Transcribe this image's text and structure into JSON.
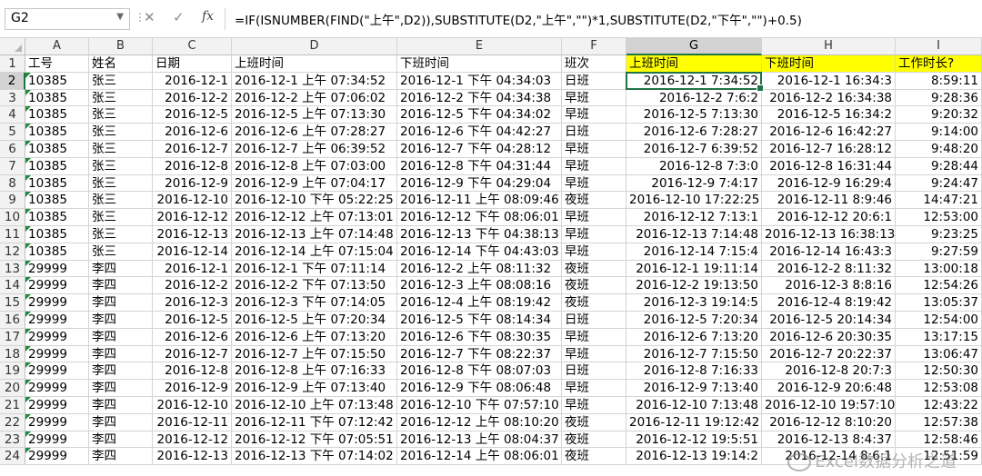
{
  "formula_bar": {
    "name_box": "G2",
    "fx": "fx",
    "cancel_icon": "✕",
    "enter_icon": "✓",
    "formula": "=IF(ISNUMBER(FIND(\"上午\",D2)),SUBSTITUTE(D2,\"上午\",\"\")*1,SUBSTITUTE(D2,\"下午\",\"\")+0.5)"
  },
  "columns": [
    "A",
    "B",
    "C",
    "D",
    "E",
    "F",
    "G",
    "H",
    "I"
  ],
  "selected_column": "G",
  "selected_row": 2,
  "highlight_color": "#ffff00",
  "header_row": [
    "工号",
    "姓名",
    "日期",
    "上班时间",
    "下班时间",
    "班次",
    "上班时间",
    "下班时间",
    "工作时长?"
  ],
  "rows": [
    [
      "10385",
      "张三",
      "2016-12-1",
      "2016-12-1 上午 07:34:52",
      "2016-12-1 下午 04:34:03",
      "日班",
      "2016-12-1 7:34:52",
      "2016-12-1 16:34:3",
      "8:59:11"
    ],
    [
      "10385",
      "张三",
      "2016-12-2",
      "2016-12-2 上午 07:06:02",
      "2016-12-2 下午 04:34:38",
      "早班",
      "2016-12-2 7:6:2",
      "2016-12-2 16:34:38",
      "9:28:36"
    ],
    [
      "10385",
      "张三",
      "2016-12-5",
      "2016-12-5 上午 07:13:30",
      "2016-12-5 下午 04:34:02",
      "早班",
      "2016-12-5 7:13:30",
      "2016-12-5 16:34:2",
      "9:20:32"
    ],
    [
      "10385",
      "张三",
      "2016-12-6",
      "2016-12-6 上午 07:28:27",
      "2016-12-6 下午 04:42:27",
      "日班",
      "2016-12-6 7:28:27",
      "2016-12-6 16:42:27",
      "9:14:00"
    ],
    [
      "10385",
      "张三",
      "2016-12-7",
      "2016-12-7 上午 06:39:52",
      "2016-12-7 下午 04:28:12",
      "早班",
      "2016-12-7 6:39:52",
      "2016-12-7 16:28:12",
      "9:48:20"
    ],
    [
      "10385",
      "张三",
      "2016-12-8",
      "2016-12-8 上午 07:03:00",
      "2016-12-8 下午 04:31:44",
      "早班",
      "2016-12-8 7:3:0",
      "2016-12-8 16:31:44",
      "9:28:44"
    ],
    [
      "10385",
      "张三",
      "2016-12-9",
      "2016-12-9 上午 07:04:17",
      "2016-12-9 下午 04:29:04",
      "早班",
      "2016-12-9 7:4:17",
      "2016-12-9 16:29:4",
      "9:24:47"
    ],
    [
      "10385",
      "张三",
      "2016-12-10",
      "2016-12-10 下午 05:22:25",
      "2016-12-11 上午 08:09:46",
      "夜班",
      "2016-12-10 17:22:25",
      "2016-12-11 8:9:46",
      "14:47:21"
    ],
    [
      "10385",
      "张三",
      "2016-12-12",
      "2016-12-12 上午 07:13:01",
      "2016-12-12 下午 08:06:01",
      "早班",
      "2016-12-12 7:13:1",
      "2016-12-12 20:6:1",
      "12:53:00"
    ],
    [
      "10385",
      "张三",
      "2016-12-13",
      "2016-12-13 上午 07:14:48",
      "2016-12-13 下午 04:38:13",
      "早班",
      "2016-12-13 7:14:48",
      "2016-12-13 16:38:13",
      "9:23:25"
    ],
    [
      "10385",
      "张三",
      "2016-12-14",
      "2016-12-14 上午 07:15:04",
      "2016-12-14 下午 04:43:03",
      "早班",
      "2016-12-14 7:15:4",
      "2016-12-14 16:43:3",
      "9:27:59"
    ],
    [
      "29999",
      "李四",
      "2016-12-1",
      "2016-12-1 下午 07:11:14",
      "2016-12-2 上午 08:11:32",
      "夜班",
      "2016-12-1 19:11:14",
      "2016-12-2 8:11:32",
      "13:00:18"
    ],
    [
      "29999",
      "李四",
      "2016-12-2",
      "2016-12-2 下午 07:13:50",
      "2016-12-3 上午 08:08:16",
      "夜班",
      "2016-12-2 19:13:50",
      "2016-12-3 8:8:16",
      "12:54:26"
    ],
    [
      "29999",
      "李四",
      "2016-12-3",
      "2016-12-3 下午 07:14:05",
      "2016-12-4 上午 08:19:42",
      "夜班",
      "2016-12-3 19:14:5",
      "2016-12-4 8:19:42",
      "13:05:37"
    ],
    [
      "29999",
      "李四",
      "2016-12-5",
      "2016-12-5 上午 07:20:34",
      "2016-12-5 下午 08:14:34",
      "日班",
      "2016-12-5 7:20:34",
      "2016-12-5 20:14:34",
      "12:54:00"
    ],
    [
      "29999",
      "李四",
      "2016-12-6",
      "2016-12-6 上午 07:13:20",
      "2016-12-6 下午 08:30:35",
      "早班",
      "2016-12-6 7:13:20",
      "2016-12-6 20:30:35",
      "13:17:15"
    ],
    [
      "29999",
      "李四",
      "2016-12-7",
      "2016-12-7 上午 07:15:50",
      "2016-12-7 下午 08:22:37",
      "早班",
      "2016-12-7 7:15:50",
      "2016-12-7 20:22:37",
      "13:06:47"
    ],
    [
      "29999",
      "李四",
      "2016-12-8",
      "2016-12-8 上午 07:16:33",
      "2016-12-8 下午 08:07:03",
      "日班",
      "2016-12-8 7:16:33",
      "2016-12-8 20:7:3",
      "12:50:30"
    ],
    [
      "29999",
      "李四",
      "2016-12-9",
      "2016-12-9 上午 07:13:40",
      "2016-12-9 下午 08:06:48",
      "早班",
      "2016-12-9 7:13:40",
      "2016-12-9 20:6:48",
      "12:53:08"
    ],
    [
      "29999",
      "李四",
      "2016-12-10",
      "2016-12-10 上午 07:13:48",
      "2016-12-10 下午 07:57:10",
      "早班",
      "2016-12-10 7:13:48",
      "2016-12-10 19:57:10",
      "12:43:22"
    ],
    [
      "29999",
      "李四",
      "2016-12-11",
      "2016-12-11 下午 07:12:42",
      "2016-12-12 上午 08:10:20",
      "夜班",
      "2016-12-11 19:12:42",
      "2016-12-12 8:10:20",
      "12:57:38"
    ],
    [
      "29999",
      "李四",
      "2016-12-12",
      "2016-12-12 下午 07:05:51",
      "2016-12-13 上午 08:04:37",
      "夜班",
      "2016-12-12 19:5:51",
      "2016-12-13 8:4:37",
      "12:58:46"
    ],
    [
      "29999",
      "李四",
      "2016-12-13",
      "2016-12-13 下午 07:14:02",
      "2016-12-14 上午 08:06:01",
      "夜班",
      "2016-12-13 19:14:2",
      "2016-12-14 8:6:1",
      "12:51:59"
    ]
  ],
  "watermark": "Excel数据分析之道"
}
